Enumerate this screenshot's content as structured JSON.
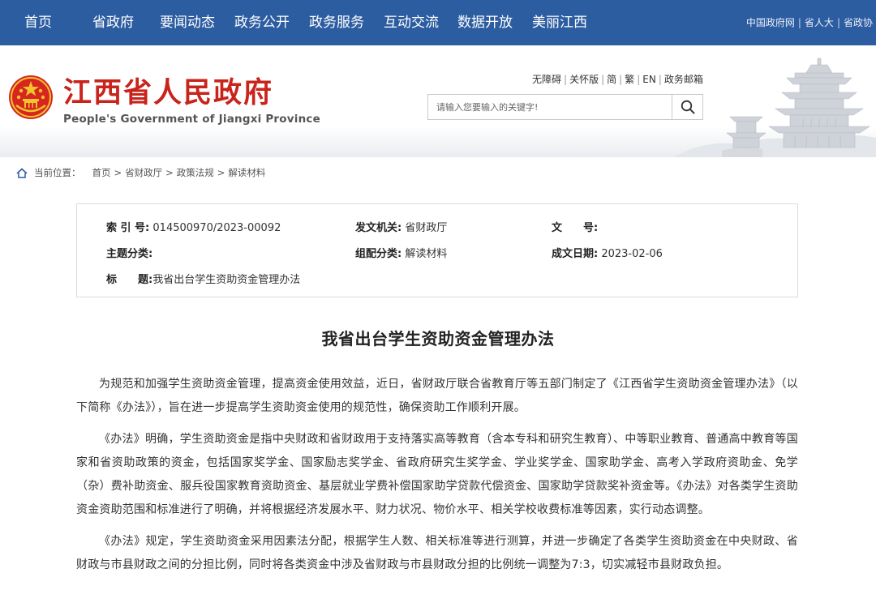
{
  "nav": {
    "items": [
      "首页",
      "省政府",
      "要闻动态",
      "政务公开",
      "政务服务",
      "互动交流",
      "数据开放",
      "美丽江西"
    ],
    "right_links": [
      "中国政府网",
      "省人大",
      "省政协"
    ],
    "bg_color": "#2d5da1"
  },
  "header": {
    "title": "江西省人民政府",
    "subtitle": "People's Government of Jiangxi Province",
    "utility_links": [
      "无障碍",
      "关怀版",
      "简",
      "繁",
      "EN",
      "政务邮箱"
    ],
    "search": {
      "placeholder": "请输入您要输入的关键字!",
      "icon": "search-icon"
    },
    "title_color": "#c9241c"
  },
  "breadcrumb": {
    "label": "当前位置：",
    "items": [
      "首页",
      "省财政厅",
      "政策法规",
      "解读材料"
    ],
    "separator": ">"
  },
  "info": {
    "index_label": "索 引 号:",
    "index_value": "014500970/2023-00092",
    "issuer_label": "发文机关:",
    "issuer_value": "省财政厅",
    "docno_label": "文　　号:",
    "docno_value": "",
    "topic_label": "主题分类:",
    "topic_value": "",
    "category_label": "组配分类:",
    "category_value": "解读材料",
    "date_label": "成文日期:",
    "date_value": "2023-02-06",
    "title_label": "标　　题:",
    "title_value": "我省出台学生资助资金管理办法"
  },
  "article": {
    "title": "我省出台学生资助资金管理办法",
    "paragraphs": [
      "为规范和加强学生资助资金管理，提高资金使用效益，近日，省财政厅联合省教育厅等五部门制定了《江西省学生资助资金管理办法》（以下简称《办法》），旨在进一步提高学生资助资金使用的规范性，确保资助工作顺利开展。",
      "《办法》明确，学生资助资金是指中央财政和省财政用于支持落实高等教育（含本专科和研究生教育）、中等职业教育、普通高中教育等国家和省资助政策的资金，包括国家奖学金、国家励志奖学金、省政府研究生奖学金、学业奖学金、国家助学金、高考入学政府资助金、免学（杂）费补助资金、服兵役国家教育资助资金、基层就业学费补偿国家助学贷款代偿资金、国家助学贷款奖补资金等。《办法》对各类学生资助资金资助范围和标准进行了明确，并将根据经济发展水平、财力状况、物价水平、相关学校收费标准等因素，实行动态调整。",
      "《办法》规定，学生资助资金采用因素法分配，根据学生人数、相关标准等进行测算，并进一步确定了各类学生资助资金在中央财政、省财政与市县财政之间的分担比例，同时将各类资金中涉及省财政与市县财政分担的比例统一调整为7:3，切实减轻市县财政负担。"
    ]
  }
}
